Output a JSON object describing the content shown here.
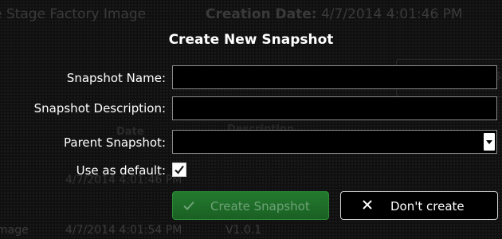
{
  "background": {
    "title": "e Stage Factory Image",
    "creation_label": "Creation Date:",
    "creation_value": "4/7/2014 4:01:46 PM",
    "date_header": "Date",
    "description_header": "Description",
    "row1_date": "4/7/2014 4:01:46 PM",
    "row2_name": "mage",
    "row2_date": "4/7/2014 4:01:54 PM",
    "row2_version": "V1.0.1",
    "panel_letter": "s"
  },
  "dialog": {
    "title": "Create New Snapshot",
    "snapshot_name_label": "Snapshot Name:",
    "snapshot_name_value": "",
    "snapshot_description_label": "Snapshot Description:",
    "snapshot_description_value": "",
    "parent_snapshot_label": "Parent Snapshot:",
    "parent_snapshot_value": "",
    "use_default_label": "Use as default:",
    "use_default_checked": true,
    "create_button_label": "Create Snapshot",
    "create_button_enabled": false,
    "cancel_button_label": "Don't create"
  },
  "colors": {
    "create_button_bg": "#1f6b29",
    "dialog_text": "#ffffff",
    "field_border": "#8c8c8c"
  },
  "icons": {
    "create_button_icon": "checkmark-icon",
    "cancel_button_icon": "close-icon",
    "dropdown_icon": "chevron-down-icon",
    "checkbox_icon": "checkmark-icon"
  }
}
